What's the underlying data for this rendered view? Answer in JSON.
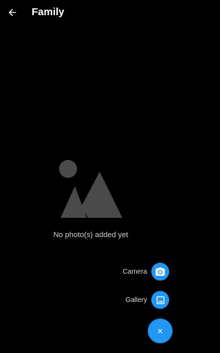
{
  "appbar": {
    "title": "Family",
    "back_icon": "arrow-back-icon"
  },
  "empty_state": {
    "icon": "image-placeholder-icon",
    "message": "No photo(s) added yet"
  },
  "actions": [
    {
      "label": "Camera",
      "icon": "camera-icon"
    },
    {
      "label": "Gallery",
      "icon": "gallery-icon"
    }
  ],
  "fab": {
    "glyph": "×",
    "icon": "close-icon"
  },
  "colors": {
    "background": "#000000",
    "accent": "#2196f3",
    "placeholder": "#4a4a4a"
  }
}
